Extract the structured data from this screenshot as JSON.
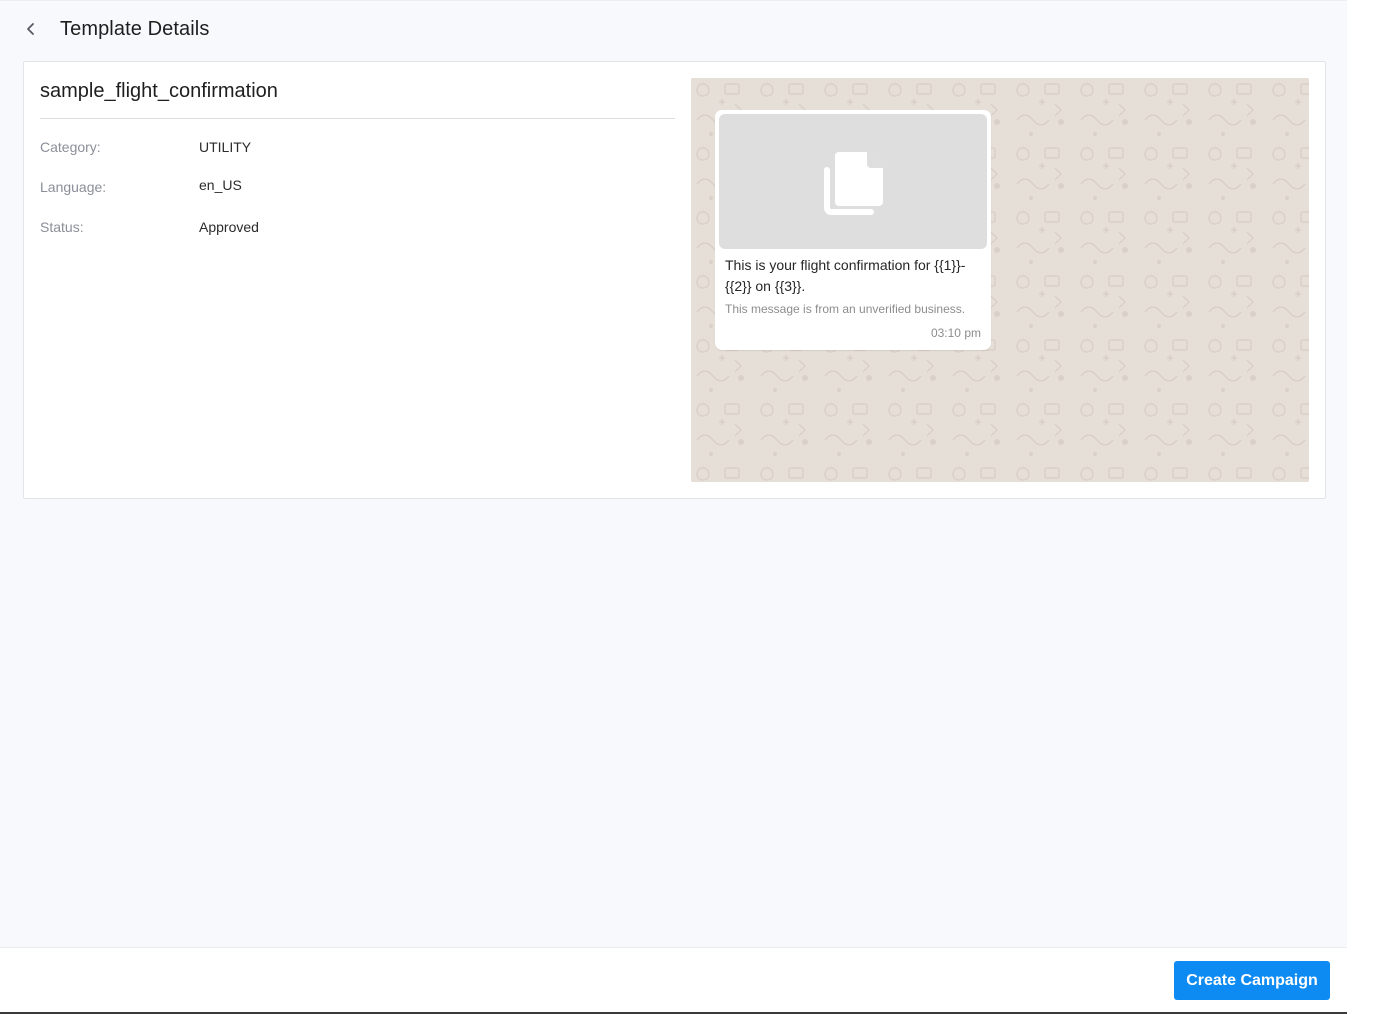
{
  "header": {
    "title": "Template Details",
    "back_icon": "chevron-left-icon"
  },
  "template": {
    "name": "sample_flight_confirmation",
    "info": [
      {
        "label": "Category:",
        "value": "UTILITY"
      },
      {
        "label": "Language:",
        "value": "en_US"
      },
      {
        "label": "Status:",
        "value": "Approved"
      }
    ]
  },
  "preview": {
    "header_icon": "document-icon",
    "body_line1": "This is your flight confirmation for {{1}}-",
    "body_line2": "{{2}} on {{3}}.",
    "footer": "This message is from an unverified business.",
    "time": "03:10 pm",
    "background_color": "#e6dfd7"
  },
  "actions": {
    "create_campaign_label": "Create Campaign"
  },
  "colors": {
    "primary": "#0d8bf2",
    "page_bg": "#f8f9fd"
  }
}
